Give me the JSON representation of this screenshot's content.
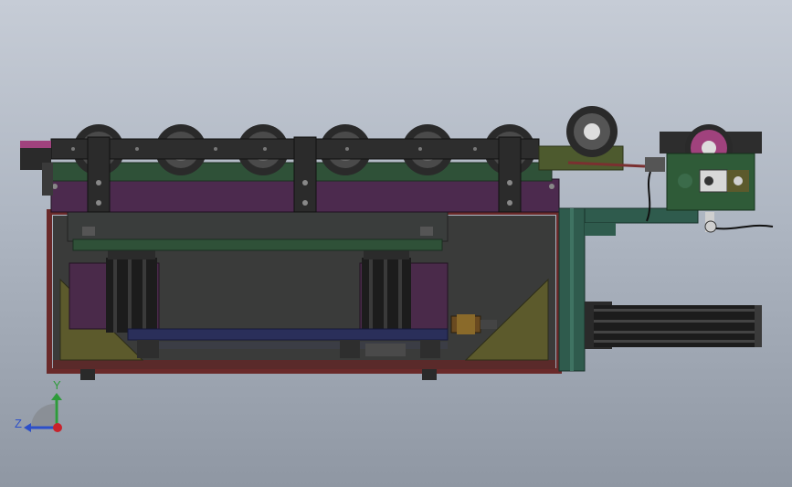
{
  "triad": {
    "y_label": "Y",
    "z_label": "Z",
    "colors": {
      "y": "#2e9b3a",
      "z": "#2c4fc9",
      "x": "#c8232c",
      "disc": "#8a8f96"
    }
  },
  "model": {
    "colors": {
      "frame_dark": "#3f3f3f",
      "frame_olive": "#5b5a26",
      "plate_purple": "#4c2a4e",
      "plate_green": "#2f5138",
      "wheel_dark": "#2a2a2a",
      "wheel_gray": "#6b6b6b",
      "rail_navy": "#2a2f5a",
      "cylinder_black": "#1c1c1c",
      "gusset_olive": "#5c5a2c",
      "accent_magenta": "#a0427d",
      "post_teal": "#2f5b4d",
      "red_frame": "#6a2a2a"
    }
  }
}
